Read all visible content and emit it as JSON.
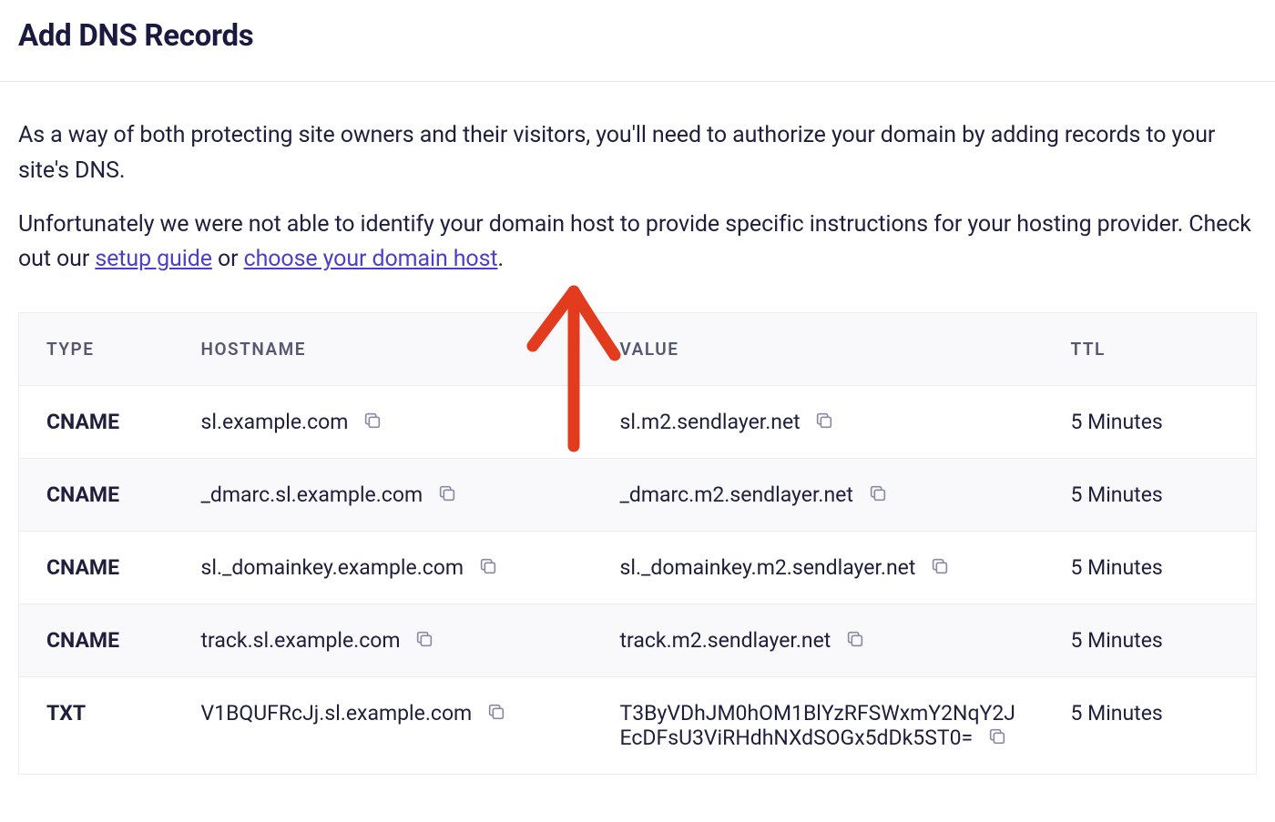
{
  "title": "Add DNS Records",
  "intro1": "As a way of both protecting site owners and their visitors, you'll need to authorize your domain by adding records to your site's DNS.",
  "intro2_pre": "Unfortunately we were not able to identify your domain host to provide specific instructions for your hosting provider. Check out our ",
  "link_setup": "setup guide",
  "intro2_mid": " or ",
  "link_choose": "choose your domain host",
  "intro2_post": ".",
  "headers": {
    "type": "TYPE",
    "hostname": "HOSTNAME",
    "value": "VALUE",
    "ttl": "TTL"
  },
  "rows": [
    {
      "type": "CNAME",
      "hostname": "sl.example.com",
      "value": "sl.m2.sendlayer.net",
      "ttl": "5 Minutes"
    },
    {
      "type": "CNAME",
      "hostname": "_dmarc.sl.example.com",
      "value": "_dmarc.m2.sendlayer.net",
      "ttl": "5 Minutes"
    },
    {
      "type": "CNAME",
      "hostname": "sl._domainkey.example.com",
      "value": "sl._domainkey.m2.sendlayer.net",
      "ttl": "5 Minutes"
    },
    {
      "type": "CNAME",
      "hostname": "track.sl.example.com",
      "value": "track.m2.sendlayer.net",
      "ttl": "5 Minutes"
    },
    {
      "type": "TXT",
      "hostname": "V1BQUFRcJj.sl.example.com",
      "value": "T3ByVDhJM0hOM1BlYzRFSWxmY2NqY2JEcDFsU3ViRHdhNXdSOGx5dDk5ST0=",
      "ttl": "5 Minutes"
    }
  ]
}
